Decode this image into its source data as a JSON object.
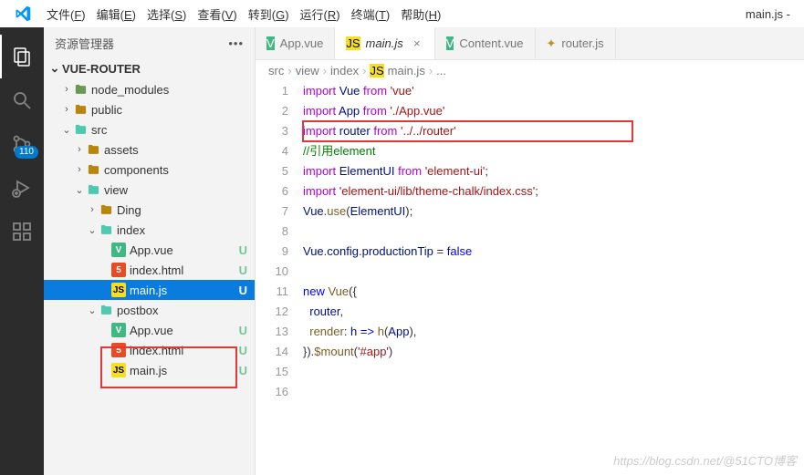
{
  "window": {
    "title": "main.js -"
  },
  "menu": {
    "items": [
      "文件(F)",
      "编辑(E)",
      "选择(S)",
      "查看(V)",
      "转到(G)",
      "运行(R)",
      "终端(T)",
      "帮助(H)"
    ]
  },
  "activity": {
    "badge": "110"
  },
  "sidebar": {
    "title": "资源管理器",
    "section": "VUE-ROUTER"
  },
  "tree": [
    {
      "indent": 1,
      "chev": "›",
      "icon": "folder-green",
      "label": "node_modules"
    },
    {
      "indent": 1,
      "chev": "›",
      "icon": "folder",
      "label": "public"
    },
    {
      "indent": 1,
      "chev": "⌄",
      "icon": "folder-open",
      "label": "src"
    },
    {
      "indent": 2,
      "chev": "›",
      "icon": "folder",
      "label": "assets"
    },
    {
      "indent": 2,
      "chev": "›",
      "icon": "folder",
      "label": "components"
    },
    {
      "indent": 2,
      "chev": "⌄",
      "icon": "folder-open",
      "label": "view"
    },
    {
      "indent": 3,
      "chev": "›",
      "icon": "folder",
      "label": "Ding"
    },
    {
      "indent": 3,
      "chev": "⌄",
      "icon": "folder-open",
      "label": "index"
    },
    {
      "indent": 4,
      "chev": "",
      "icon": "vue",
      "label": "App.vue",
      "status": "U"
    },
    {
      "indent": 4,
      "chev": "",
      "icon": "html",
      "label": "index.html",
      "status": "U"
    },
    {
      "indent": 4,
      "chev": "",
      "icon": "js",
      "label": "main.js",
      "status": "U",
      "selected": true
    },
    {
      "indent": 3,
      "chev": "⌄",
      "icon": "folder-open",
      "label": "postbox"
    },
    {
      "indent": 4,
      "chev": "",
      "icon": "vue",
      "label": "App.vue",
      "status": "U"
    },
    {
      "indent": 4,
      "chev": "",
      "icon": "html",
      "label": "index.html",
      "status": "U"
    },
    {
      "indent": 4,
      "chev": "",
      "icon": "js",
      "label": "main.js",
      "status": "U"
    }
  ],
  "tabs": [
    {
      "icon": "vue",
      "label": "App.vue"
    },
    {
      "icon": "js",
      "label": "main.js",
      "active": true,
      "close": "×"
    },
    {
      "icon": "vue",
      "label": "Content.vue"
    },
    {
      "icon": "js-alt",
      "label": "router.js"
    }
  ],
  "breadcrumbs": [
    "src",
    "view",
    "index",
    "main.js",
    "..."
  ],
  "bc_icon": "js",
  "code": {
    "lines": 16,
    "content": [
      [
        [
          "kw",
          "import"
        ],
        [
          "pl",
          " "
        ],
        [
          "var",
          "Vue"
        ],
        [
          "pl",
          " "
        ],
        [
          "kw",
          "from"
        ],
        [
          "pl",
          " "
        ],
        [
          "str",
          "'vue'"
        ]
      ],
      [
        [
          "kw",
          "import"
        ],
        [
          "pl",
          " "
        ],
        [
          "var",
          "App"
        ],
        [
          "pl",
          " "
        ],
        [
          "kw",
          "from"
        ],
        [
          "pl",
          " "
        ],
        [
          "str",
          "'./App.vue'"
        ]
      ],
      [
        [
          "kw",
          "import"
        ],
        [
          "pl",
          " "
        ],
        [
          "var",
          "router"
        ],
        [
          "pl",
          " "
        ],
        [
          "kw",
          "from"
        ],
        [
          "pl",
          " "
        ],
        [
          "str",
          "'../../router'"
        ]
      ],
      [
        [
          "cm",
          "//引用element"
        ]
      ],
      [
        [
          "kw",
          "import"
        ],
        [
          "pl",
          " "
        ],
        [
          "var",
          "ElementUI"
        ],
        [
          "pl",
          " "
        ],
        [
          "kw",
          "from"
        ],
        [
          "pl",
          " "
        ],
        [
          "str",
          "'element-ui'"
        ],
        [
          "pl",
          ";"
        ]
      ],
      [
        [
          "kw",
          "import"
        ],
        [
          "pl",
          " "
        ],
        [
          "str",
          "'element-ui/lib/theme-chalk/index.css'"
        ],
        [
          "pl",
          ";"
        ]
      ],
      [
        [
          "var",
          "Vue"
        ],
        [
          "pl",
          "."
        ],
        [
          "fn",
          "use"
        ],
        [
          "pl",
          "("
        ],
        [
          "var",
          "ElementUI"
        ],
        [
          "pl",
          ");"
        ]
      ],
      [],
      [
        [
          "var",
          "Vue"
        ],
        [
          "pl",
          "."
        ],
        [
          "var",
          "config"
        ],
        [
          "pl",
          "."
        ],
        [
          "var",
          "productionTip"
        ],
        [
          "pl",
          " = "
        ],
        [
          "arrow",
          "false"
        ]
      ],
      [],
      [
        [
          "arrow",
          "new"
        ],
        [
          "pl",
          " "
        ],
        [
          "fn",
          "Vue"
        ],
        [
          "pl",
          "({"
        ]
      ],
      [
        [
          "pl",
          "  "
        ],
        [
          "var",
          "router"
        ],
        [
          "pl",
          ","
        ]
      ],
      [
        [
          "pl",
          "  "
        ],
        [
          "fn",
          "render"
        ],
        [
          "pl",
          ": "
        ],
        [
          "var",
          "h"
        ],
        [
          "pl",
          " "
        ],
        [
          "arrow",
          "=>"
        ],
        [
          "pl",
          " "
        ],
        [
          "fn",
          "h"
        ],
        [
          "pl",
          "("
        ],
        [
          "var",
          "App"
        ],
        [
          "pl",
          "),"
        ]
      ],
      [
        [
          "pl",
          "})."
        ],
        [
          "fn",
          "$mount"
        ],
        [
          "pl",
          "("
        ],
        [
          "str",
          "'#app'"
        ],
        [
          "pl",
          ")"
        ]
      ],
      [],
      []
    ]
  },
  "watermark": "https://blog.csdn.net/@51CTO博客"
}
